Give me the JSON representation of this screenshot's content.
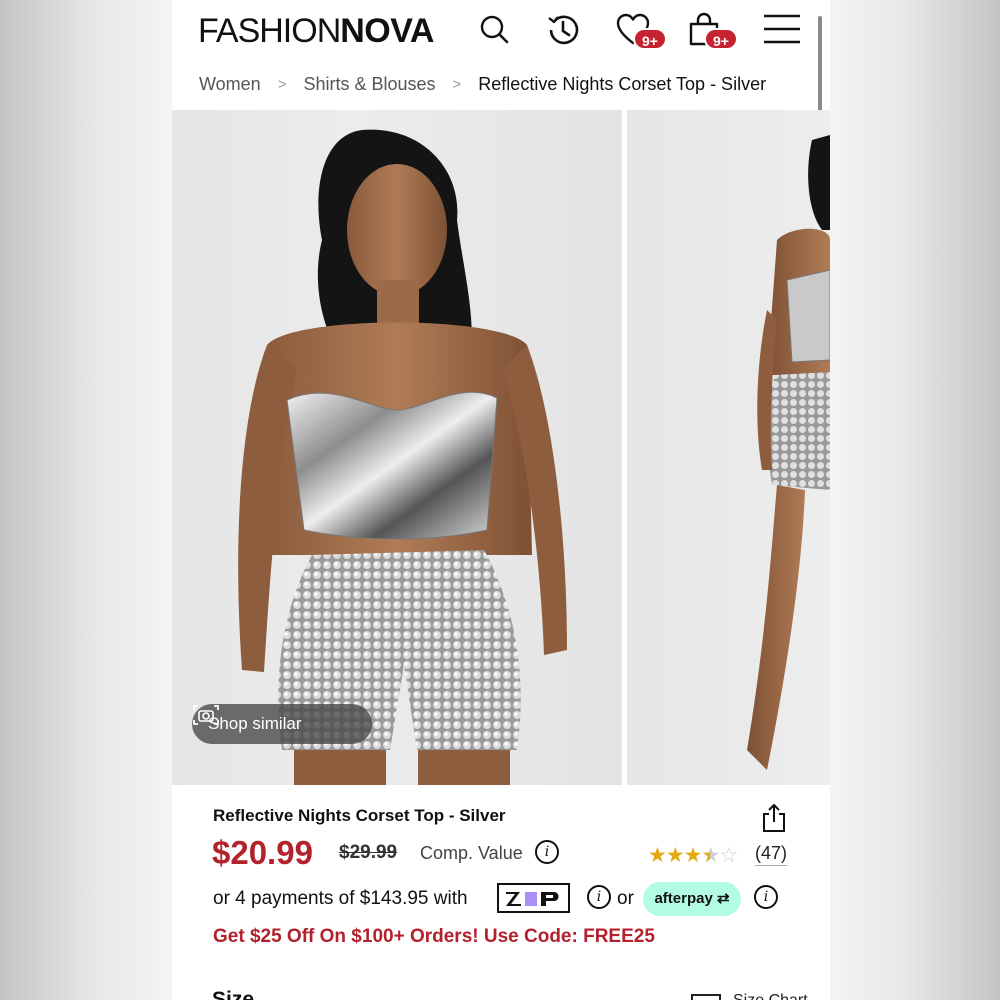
{
  "header": {
    "logo_light": "FASHION",
    "logo_bold": "NOVA",
    "wishlist_badge": "9+",
    "cart_badge": "9+"
  },
  "breadcrumb": {
    "items": [
      "Women",
      "Shirts & Blouses",
      "Reflective Nights Corset Top - Silver"
    ]
  },
  "gallery": {
    "shop_similar_label": "Shop similar"
  },
  "product": {
    "title": "Reflective Nights Corset Top - Silver",
    "price": "$20.99",
    "original_price": "$29.99",
    "comp_value_label": "Comp. Value",
    "rating": 3.5,
    "rating_max": 5,
    "review_count": "(47)",
    "installments_text": "or 4 payments of $143.95 with",
    "zip_label": "zip",
    "or_label": "or",
    "afterpay_label": "afterpay",
    "promo_text": "Get $25 Off On $100+ Orders! Use Code: FREE25",
    "size_label": "Size",
    "size_chart_label": "Size Chart"
  },
  "colors": {
    "price_red": "#b3212d",
    "badge_red": "#c4232f",
    "star_gold": "#e2a913",
    "afterpay_mint": "#b2fce4",
    "zip_purple": "#aa8ff5"
  },
  "icons": [
    "search-icon",
    "history-icon",
    "heart-icon",
    "bag-icon",
    "menu-icon",
    "camera-icon",
    "share-icon",
    "info-icon"
  ]
}
